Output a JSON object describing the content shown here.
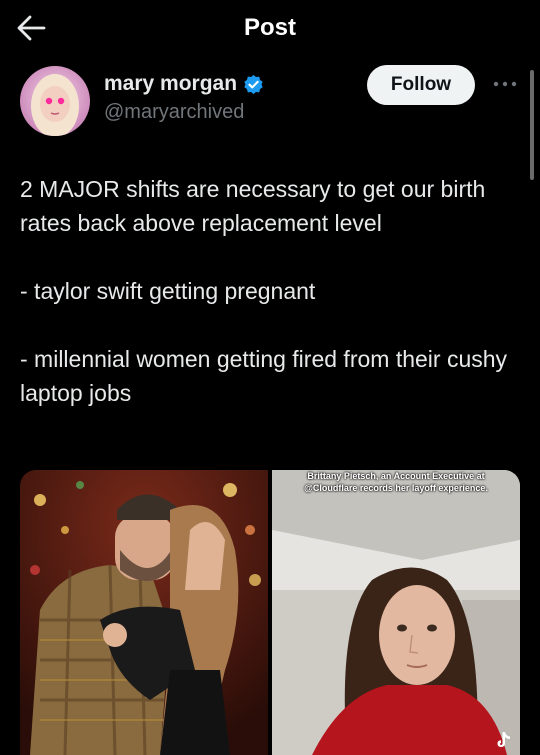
{
  "header": {
    "title": "Post"
  },
  "author": {
    "name": "mary morgan",
    "handle": "@maryarchived",
    "verified": true
  },
  "actions": {
    "follow_label": "Follow"
  },
  "tweet": {
    "paragraphs": [
      "2 MAJOR shifts are necessary to get our birth rates back above replacement level",
      "- taylor swift getting pregnant",
      "- millennial women getting fired from their cushy laptop jobs"
    ]
  },
  "media": {
    "video_caption": "Brittany Pietsch, an Account Executive at @Cloudflare records her layoff experience."
  },
  "colors": {
    "background": "#000000",
    "text": "#e7e9ea",
    "secondary_text": "#71767b",
    "verified_blue": "#1d9bf0",
    "follow_button_bg": "#eff3f4"
  }
}
